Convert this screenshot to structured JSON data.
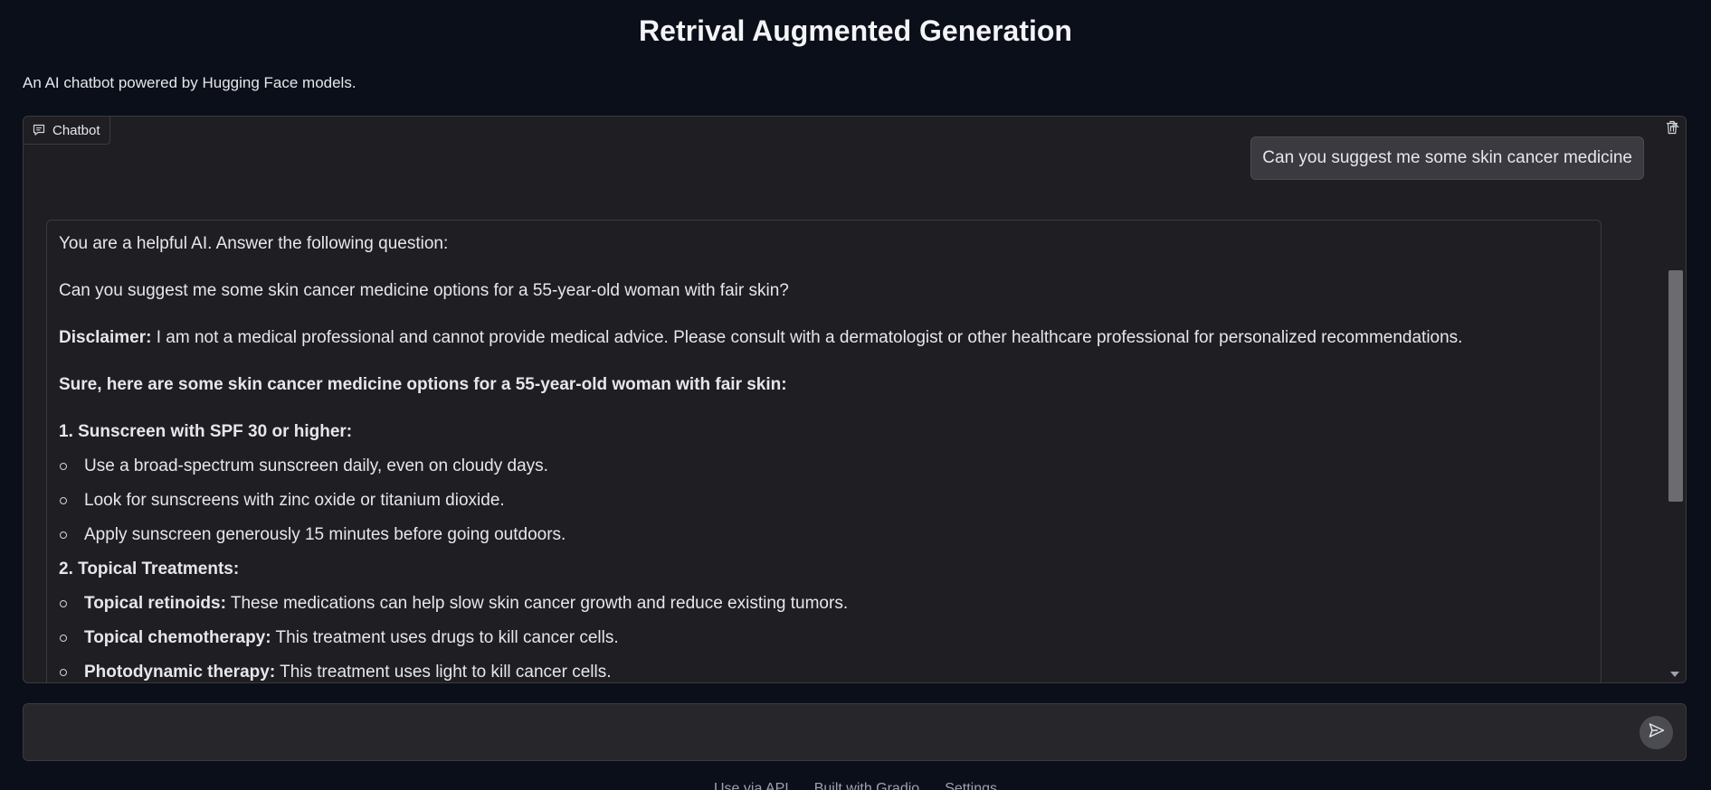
{
  "header": {
    "title": "Retrival Augmented Generation",
    "description": "An AI chatbot powered by Hugging Face models."
  },
  "chatbot": {
    "label": "Chatbot",
    "icons": {
      "label_icon": "chat-bubble-icon",
      "clear": "trash-icon"
    },
    "user_message": "Can you suggest me some skin cancer medicine",
    "bot_message": {
      "intro": "You are a helpful AI. Answer the following question:",
      "question": "Can you suggest me some skin cancer medicine options for a 55-year-old woman with fair skin?",
      "disclaimer_label": "Disclaimer:",
      "disclaimer_text": " I am not a medical professional and cannot provide medical advice. Please consult with a dermatologist or other healthcare professional for personalized recommendations.",
      "lead": "Sure, here are some skin cancer medicine options for a 55-year-old woman with fair skin:",
      "section1_title": "1. Sunscreen with SPF 30 or higher:",
      "section1_items": [
        "Use a broad-spectrum sunscreen daily, even on cloudy days.",
        "Look for sunscreens with zinc oxide or titanium dioxide.",
        "Apply sunscreen generously 15 minutes before going outdoors."
      ],
      "section2_title": "2. Topical Treatments:",
      "section2_items": [
        {
          "label": "Topical retinoids:",
          "text": " These medications can help slow skin cancer growth and reduce existing tumors."
        },
        {
          "label": "Topical chemotherapy:",
          "text": " This treatment uses drugs to kill cancer cells."
        },
        {
          "label": "Photodynamic therapy:",
          "text": " This treatment uses light to kill cancer cells."
        }
      ]
    }
  },
  "input": {
    "placeholder": "",
    "value": "",
    "send_icon": "send-icon"
  },
  "footer": {
    "api": "Use via API",
    "built": "Built with Gradio",
    "settings": "Settings"
  },
  "colors": {
    "background": "#0b0f19",
    "panel": "#1f1f23",
    "border": "#3a3a3f",
    "user_bubble": "#3a3a40"
  }
}
